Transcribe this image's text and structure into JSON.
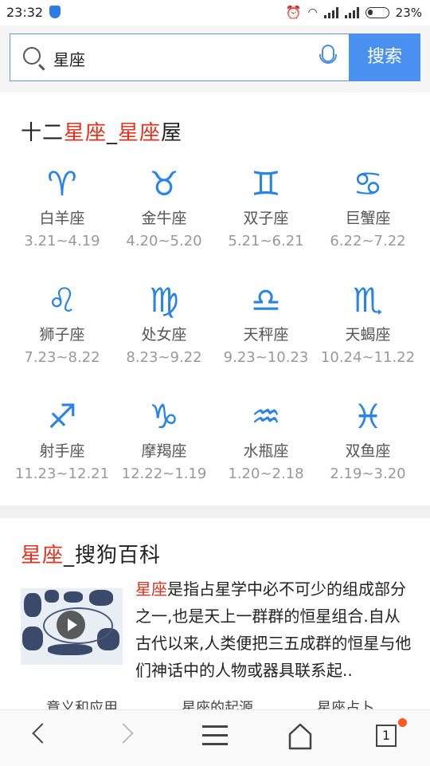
{
  "status": {
    "time": "23:32",
    "battery": "23%"
  },
  "search": {
    "query": "星座",
    "button": "搜索"
  },
  "card1": {
    "title_parts": [
      "十二",
      "星座",
      "_",
      "星座",
      "屋"
    ],
    "items": [
      {
        "glyph": "♈",
        "name": "白羊座",
        "date": "3.21~4.19"
      },
      {
        "glyph": "♉",
        "name": "金牛座",
        "date": "4.20~5.20"
      },
      {
        "glyph": "♊",
        "name": "双子座",
        "date": "5.21~6.21"
      },
      {
        "glyph": "♋",
        "name": "巨蟹座",
        "date": "6.22~7.22"
      },
      {
        "glyph": "♌",
        "name": "狮子座",
        "date": "7.23~8.22"
      },
      {
        "glyph": "♍",
        "name": "处女座",
        "date": "8.23~9.22"
      },
      {
        "glyph": "♎",
        "name": "天秤座",
        "date": "9.23~10.23"
      },
      {
        "glyph": "♏",
        "name": "天蝎座",
        "date": "10.24~11.22"
      },
      {
        "glyph": "♐",
        "name": "射手座",
        "date": "11.23~12.21"
      },
      {
        "glyph": "♑",
        "name": "摩羯座",
        "date": "12.22~1.19"
      },
      {
        "glyph": "♒",
        "name": "水瓶座",
        "date": "1.20~2.18"
      },
      {
        "glyph": "♓",
        "name": "双鱼座",
        "date": "2.19~3.20"
      }
    ],
    "icons": [
      "aries-icon",
      "taurus-icon",
      "gemini-icon",
      "cancer-icon",
      "leo-icon",
      "virgo-icon",
      "libra-icon",
      "scorpio-icon",
      "sagittarius-icon",
      "capricorn-icon",
      "aquarius-icon",
      "pisces-icon"
    ]
  },
  "card2": {
    "title_hl": "星座",
    "title_rest": "_搜狗百科",
    "desc_hl": "星座",
    "desc_rest": "是指占星学中必不可少的组成部分之一,也是天上一群群的恒星组合.自从古代以来,人类便把三五成群的恒星与他们神话中的人物或器具联系起..",
    "related": [
      "意义和应用",
      "星座的起源",
      "星座占卜"
    ]
  },
  "bottom": {
    "tab_count": "1"
  },
  "colors": {
    "accent": "#4a90f0",
    "highlight": "#e0321e",
    "glyph": "#2a84e6"
  }
}
